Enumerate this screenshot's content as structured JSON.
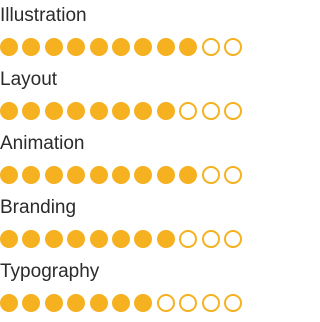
{
  "colors": {
    "accent": "#f5b120",
    "text": "#2b2b2b"
  },
  "skills": [
    {
      "name": "Illustration",
      "rating": 9,
      "max": 11
    },
    {
      "name": "Layout",
      "rating": 8,
      "max": 11
    },
    {
      "name": "Animation",
      "rating": 9,
      "max": 11
    },
    {
      "name": "Branding",
      "rating": 8,
      "max": 11
    },
    {
      "name": "Typography",
      "rating": 7,
      "max": 11
    }
  ]
}
